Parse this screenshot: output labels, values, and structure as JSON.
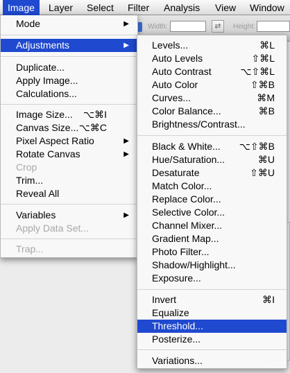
{
  "menubar": {
    "items": [
      {
        "label": "Image"
      },
      {
        "label": "Layer"
      },
      {
        "label": "Select"
      },
      {
        "label": "Filter"
      },
      {
        "label": "Analysis"
      },
      {
        "label": "View"
      },
      {
        "label": "Window"
      }
    ]
  },
  "options_bar": {
    "width_label": "Width:",
    "height_label": "Height:",
    "swap_glyph": "⇄"
  },
  "image_menu": {
    "items": [
      {
        "label": "Mode",
        "submenu": true
      },
      {
        "label": "Adjustments",
        "submenu": true,
        "highlighted": true
      },
      {
        "label": "Duplicate..."
      },
      {
        "label": "Apply Image..."
      },
      {
        "label": "Calculations..."
      },
      {
        "label": "Image Size...",
        "shortcut": "⌥⌘I"
      },
      {
        "label": "Canvas Size...",
        "shortcut": "⌥⌘C"
      },
      {
        "label": "Pixel Aspect Ratio",
        "submenu": true
      },
      {
        "label": "Rotate Canvas",
        "submenu": true
      },
      {
        "label": "Crop",
        "disabled": true
      },
      {
        "label": "Trim..."
      },
      {
        "label": "Reveal All"
      },
      {
        "label": "Variables",
        "submenu": true
      },
      {
        "label": "Apply Data Set...",
        "disabled": true
      },
      {
        "label": "Trap...",
        "disabled": true
      }
    ]
  },
  "adjustments_menu": {
    "items": [
      {
        "label": "Levels...",
        "shortcut": "⌘L"
      },
      {
        "label": "Auto Levels",
        "shortcut": "⇧⌘L"
      },
      {
        "label": "Auto Contrast",
        "shortcut": "⌥⇧⌘L"
      },
      {
        "label": "Auto Color",
        "shortcut": "⇧⌘B"
      },
      {
        "label": "Curves...",
        "shortcut": "⌘M"
      },
      {
        "label": "Color Balance...",
        "shortcut": "⌘B"
      },
      {
        "label": "Brightness/Contrast..."
      },
      {
        "label": "Black & White...",
        "shortcut": "⌥⇧⌘B"
      },
      {
        "label": "Hue/Saturation...",
        "shortcut": "⌘U"
      },
      {
        "label": "Desaturate",
        "shortcut": "⇧⌘U"
      },
      {
        "label": "Match Color..."
      },
      {
        "label": "Replace Color..."
      },
      {
        "label": "Selective Color..."
      },
      {
        "label": "Channel Mixer..."
      },
      {
        "label": "Gradient Map..."
      },
      {
        "label": "Photo Filter..."
      },
      {
        "label": "Shadow/Highlight..."
      },
      {
        "label": "Exposure..."
      },
      {
        "label": "Invert",
        "shortcut": "⌘I"
      },
      {
        "label": "Equalize"
      },
      {
        "label": "Threshold...",
        "highlighted": true
      },
      {
        "label": "Posterize..."
      },
      {
        "label": "Variations..."
      }
    ]
  },
  "colors": {
    "highlight": "#1f49cf",
    "disabled_text": "#a8a8a8"
  },
  "icons": {
    "submenu_arrow": "▶"
  }
}
